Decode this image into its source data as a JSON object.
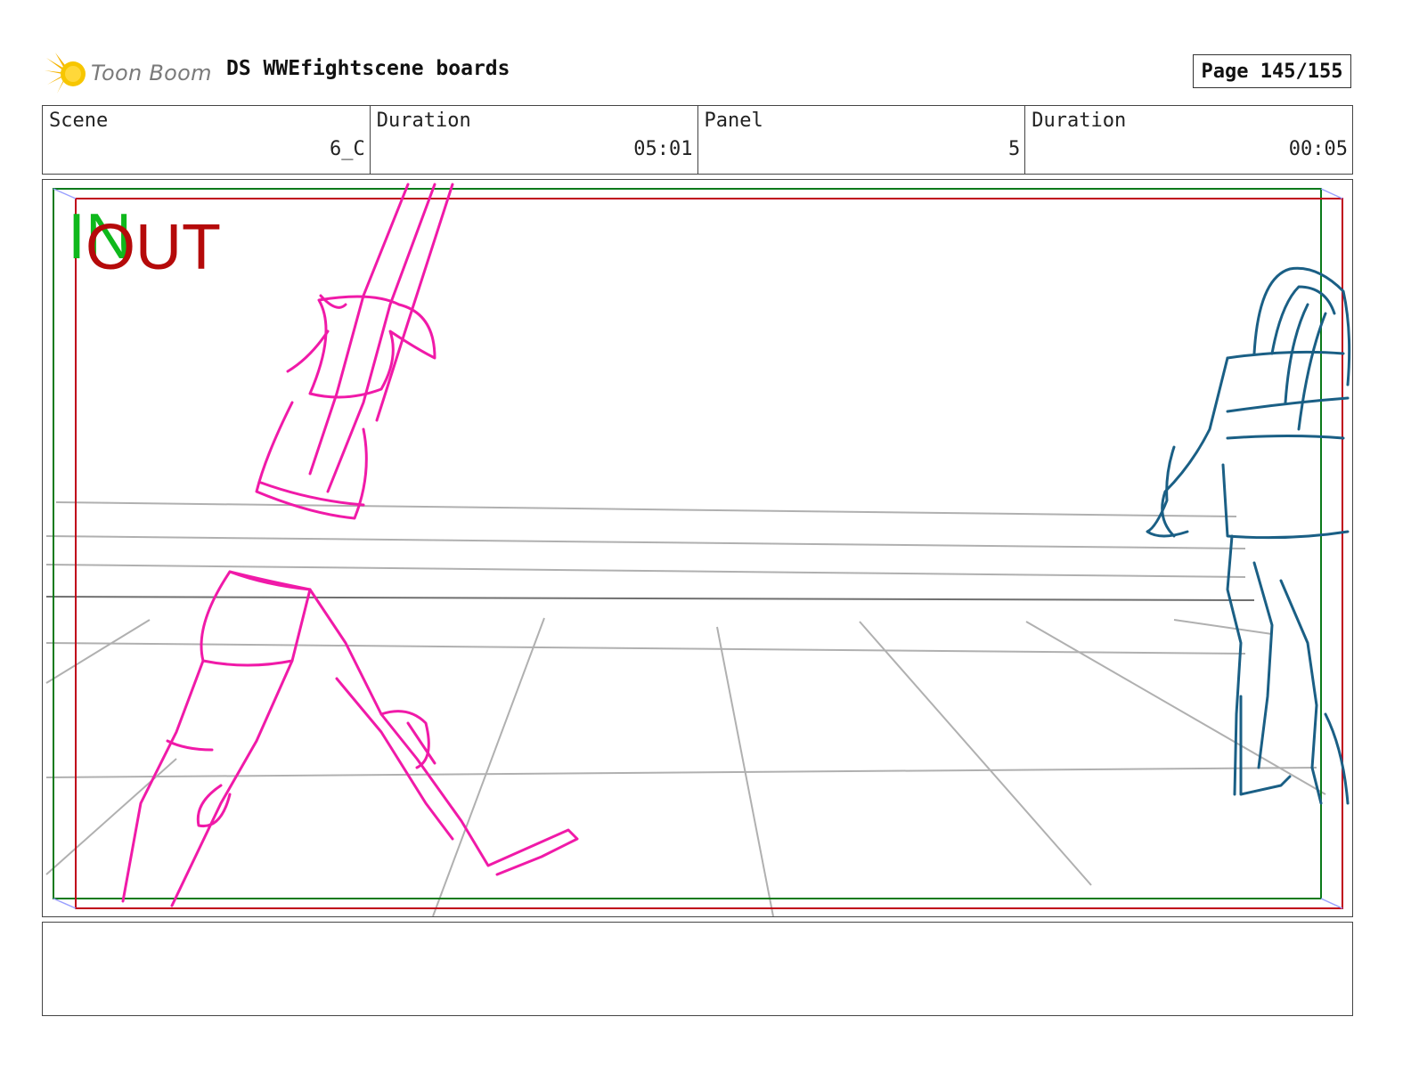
{
  "header": {
    "logo_text": "Toon Boom",
    "document_title": "DS WWEfightscene boards",
    "page_indicator": "Page 145/155"
  },
  "info": {
    "scene_label": "Scene",
    "scene_value": "6_C",
    "scene_duration_label": "Duration",
    "scene_duration_value": "05:01",
    "panel_label": "Panel",
    "panel_value": "5",
    "panel_duration_label": "Duration",
    "panel_duration_value": "00:05"
  },
  "panel": {
    "in_marker": "IN",
    "out_marker": "OUT",
    "colors": {
      "in_frame": "#0a7a1a",
      "out_frame": "#c0001a",
      "fighter_left": "#f01aa8",
      "fighter_right": "#1a5f85",
      "ring_lines": "#b0b0b0"
    }
  },
  "notes": {
    "text": ""
  }
}
